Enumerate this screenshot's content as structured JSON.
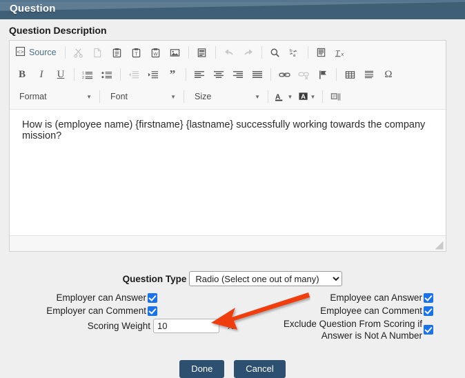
{
  "window": {
    "title": "Question",
    "header_color_top": "#5e7d95",
    "header_color_bottom": "#3f5f77"
  },
  "section": {
    "label": "Question Description"
  },
  "editor": {
    "toolbar_row1": [
      {
        "name": "source-button",
        "label": "Source",
        "icon": "source-icon",
        "disabled": false
      },
      {
        "name": "cut-button",
        "label": "Cut",
        "icon": "scissors-icon",
        "disabled": true
      },
      {
        "name": "copy-button",
        "label": "Copy",
        "icon": "copy-icon",
        "disabled": true
      },
      {
        "name": "paste-button",
        "label": "Paste",
        "icon": "clipboard-icon",
        "disabled": false
      },
      {
        "name": "paste-text-button",
        "label": "Paste as plain text",
        "icon": "clipboard-text-icon",
        "disabled": false
      },
      {
        "name": "paste-word-button",
        "label": "Paste from Word",
        "icon": "clipboard-word-icon",
        "disabled": false
      },
      {
        "name": "image-button",
        "label": "Image",
        "icon": "image-icon",
        "disabled": false
      },
      {
        "name": "templates-button",
        "label": "Templates",
        "icon": "templates-icon",
        "disabled": false
      },
      {
        "name": "undo-button",
        "label": "Undo",
        "icon": "undo-arrow-icon",
        "disabled": true
      },
      {
        "name": "redo-button",
        "label": "Redo",
        "icon": "redo-arrow-icon",
        "disabled": true
      },
      {
        "name": "find-button",
        "label": "Find",
        "icon": "magnifier-icon",
        "disabled": false
      },
      {
        "name": "replace-button",
        "label": "Replace",
        "icon": "replace-icon",
        "disabled": false
      },
      {
        "name": "select-all-button",
        "label": "Select All",
        "icon": "select-all-icon",
        "disabled": false
      },
      {
        "name": "remove-format-button",
        "label": "Remove Format",
        "icon": "remove-format-icon",
        "disabled": false
      }
    ],
    "toolbar_row2": [
      {
        "name": "bold-button",
        "label": "B",
        "icon": "bold-icon",
        "disabled": false
      },
      {
        "name": "italic-button",
        "label": "I",
        "icon": "italic-icon",
        "disabled": false
      },
      {
        "name": "underline-button",
        "label": "U",
        "icon": "underline-icon",
        "disabled": false
      },
      {
        "name": "numbered-list-button",
        "label": "Insert/Remove Numbered List",
        "icon": "numbered-list-icon",
        "disabled": false
      },
      {
        "name": "bulleted-list-button",
        "label": "Insert/Remove Bulleted List",
        "icon": "bulleted-list-icon",
        "disabled": false
      },
      {
        "name": "outdent-button",
        "label": "Decrease Indent",
        "icon": "outdent-icon",
        "disabled": true
      },
      {
        "name": "indent-button",
        "label": "Increase Indent",
        "icon": "indent-icon",
        "disabled": false
      },
      {
        "name": "blockquote-button",
        "label": "Block Quote",
        "icon": "quote-icon",
        "disabled": false
      },
      {
        "name": "align-left-button",
        "label": "Align Left",
        "icon": "align-left-icon",
        "disabled": false
      },
      {
        "name": "align-center-button",
        "label": "Center",
        "icon": "align-center-icon",
        "disabled": false
      },
      {
        "name": "align-right-button",
        "label": "Align Right",
        "icon": "align-right-icon",
        "disabled": false
      },
      {
        "name": "align-justify-button",
        "label": "Justify",
        "icon": "align-justify-icon",
        "disabled": false
      },
      {
        "name": "link-button",
        "label": "Link",
        "icon": "link-icon",
        "disabled": false
      },
      {
        "name": "unlink-button",
        "label": "Unlink",
        "icon": "unlink-icon",
        "disabled": true
      },
      {
        "name": "anchor-button",
        "label": "Anchor",
        "icon": "flag-icon",
        "disabled": false
      },
      {
        "name": "table-button",
        "label": "Table",
        "icon": "table-icon",
        "disabled": false
      },
      {
        "name": "horizontal-rule-button",
        "label": "Horizontal Line",
        "icon": "horizontal-rule-icon",
        "disabled": false
      },
      {
        "name": "special-char-button",
        "label": "Ω",
        "icon": "omega-icon",
        "disabled": false
      }
    ],
    "toolbar_row3": {
      "format_label": "Format",
      "font_label": "Font",
      "size_label": "Size",
      "text_color_label": "A",
      "bg_color_label": "A",
      "maximize_label": "Maximize"
    },
    "content": "How is (employee name) {firstname} {lastname} successfully working towards the company mission?"
  },
  "form": {
    "question_type_label": "Question Type",
    "question_type_value": "Radio (Select one out of many)",
    "question_type_options": [
      "Radio (Select one out of many)"
    ],
    "employer_can_answer_label": "Employer can Answer",
    "employer_can_answer_checked": true,
    "employer_can_comment_label": "Employer can Comment",
    "employer_can_comment_checked": true,
    "employee_can_answer_label": "Employee can Answer",
    "employee_can_answer_checked": true,
    "employee_can_comment_label": "Employee can Comment",
    "employee_can_comment_checked": true,
    "exclude_label_line1": "Exclude Question From Scoring if",
    "exclude_label_line2": "Answer is Not A Number",
    "exclude_checked": true,
    "scoring_weight_label": "Scoring Weight",
    "scoring_weight_value": "10",
    "percent_symbol": "%",
    "done_label": "Done",
    "cancel_label": "Cancel"
  },
  "annotation": {
    "arrow_color": "#f03c10",
    "arrow_points_to": "Scoring Weight field"
  }
}
